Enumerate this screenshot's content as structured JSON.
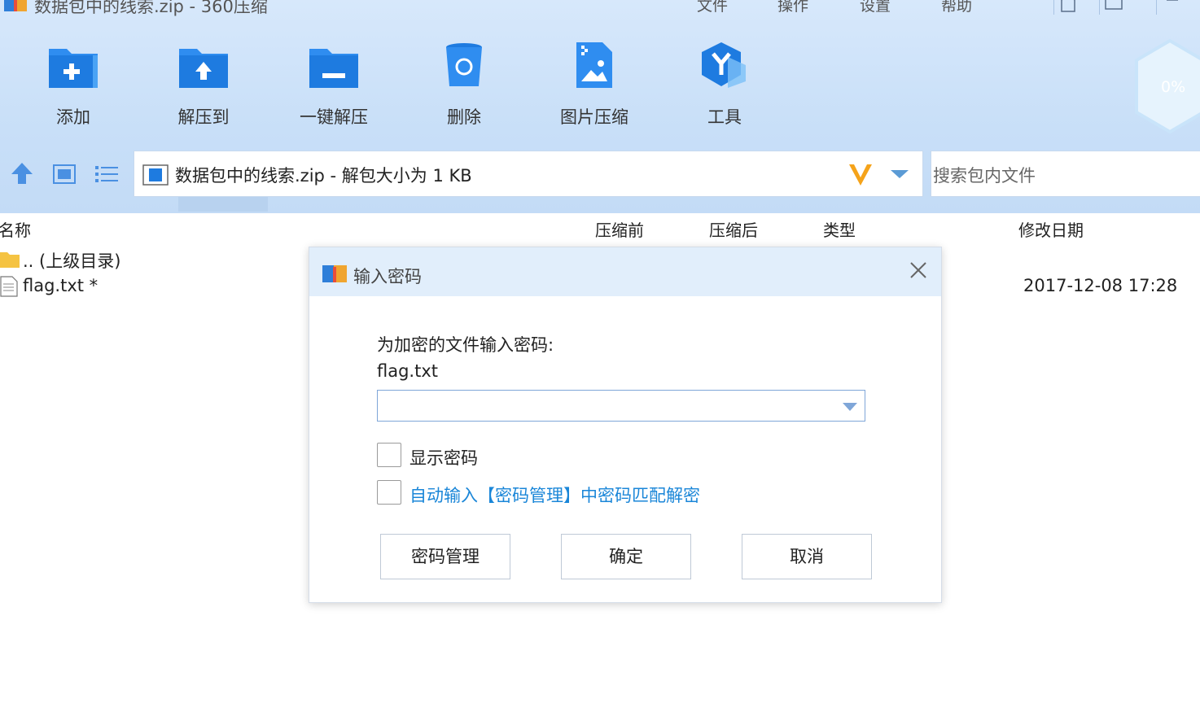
{
  "window": {
    "title": "数据包中的线索.zip - 360压缩",
    "menu": [
      "文件",
      "操作",
      "设置",
      "帮助"
    ]
  },
  "toolbar": {
    "items": [
      {
        "label": "添加",
        "icon": "add-folder-icon"
      },
      {
        "label": "解压到",
        "icon": "extract-to-icon"
      },
      {
        "label": "一键解压",
        "icon": "one-click-extract-icon"
      },
      {
        "label": "删除",
        "icon": "delete-bin-icon"
      },
      {
        "label": "图片压缩",
        "icon": "image-compress-icon"
      },
      {
        "label": "工具",
        "icon": "tools-icon"
      }
    ],
    "progress": "0%"
  },
  "pathbar": {
    "path": "数据包中的线索.zip - 解包大小为 1 KB"
  },
  "search": {
    "placeholder": "搜索包内文件"
  },
  "columns": {
    "name": "名称",
    "before": "压缩前",
    "after": "压缩后",
    "type": "类型",
    "modified": "修改日期"
  },
  "files": [
    {
      "name": ".. (上级目录)",
      "modified": ""
    },
    {
      "name": "flag.txt *",
      "modified": "2017-12-08 17:28"
    }
  ],
  "dialog": {
    "title": "输入密码",
    "prompt": "为加密的文件输入密码:",
    "filename": "flag.txt",
    "password_value": "",
    "show_password_label": "显示密码",
    "auto_input_label": "自动输入【密码管理】中密码匹配解密",
    "buttons": {
      "manage": "密码管理",
      "ok": "确定",
      "cancel": "取消"
    },
    "link_color": "#1a86d8"
  }
}
